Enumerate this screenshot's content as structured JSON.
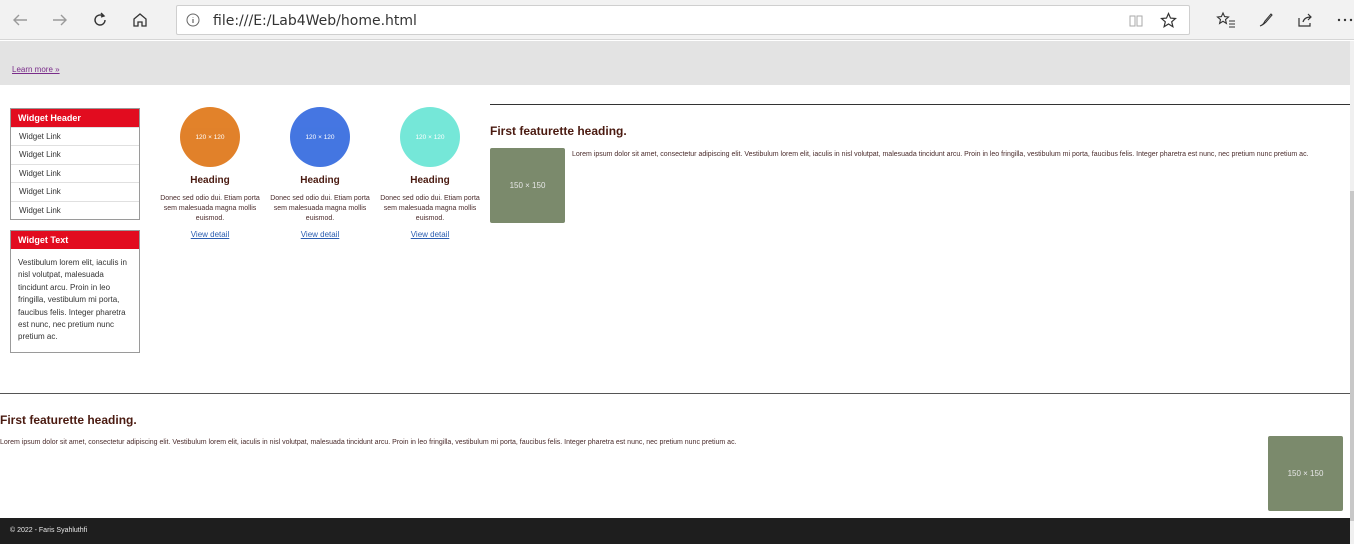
{
  "browser": {
    "url": "file:///E:/Lab4Web/home.html"
  },
  "jumbotron": {
    "learn_more": "Learn more »"
  },
  "sidebar": {
    "widget1": {
      "header": "Widget Header",
      "links": [
        "Widget Link",
        "Widget Link",
        "Widget Link",
        "Widget Link",
        "Widget Link"
      ]
    },
    "widget2": {
      "header": "Widget Text",
      "text": "Vestibulum lorem elit, iaculis in nisl volutpat, malesuada tincidunt arcu. Proin in leo fringilla, vestibulum mi porta, faucibus felis. Integer pharetra est nunc, nec pretium nunc pretium ac."
    }
  },
  "cards": [
    {
      "placeholder": "120 × 120",
      "color": "#e07b1f",
      "heading": "Heading",
      "text": "Donec sed odio dui. Etiam porta sem malesuada magna mollis euismod.",
      "link": "View detail"
    },
    {
      "placeholder": "120 × 120",
      "color": "#3b6fe0",
      "heading": "Heading",
      "text": "Donec sed odio dui. Etiam porta sem malesuada magna mollis euismod.",
      "link": "View detail"
    },
    {
      "placeholder": "120 × 120",
      "color": "#6ee6d6",
      "heading": "Heading",
      "text": "Donec sed odio dui. Etiam porta sem malesuada magna mollis euismod.",
      "link": "View detail"
    }
  ],
  "featurette1": {
    "heading": "First featurette heading.",
    "image": "150 × 150",
    "text": "Lorem ipsum dolor sit amet, consectetur adipiscing elit. Vestibulum lorem elit, iaculis in nisl volutpat, malesuada tincidunt arcu. Proin in leo fringilla, vestibulum mi porta, faucibus felis. Integer pharetra est nunc, nec pretium nunc pretium ac."
  },
  "featurette2": {
    "heading": "First featurette heading.",
    "image": "150 × 150",
    "text": "Lorem ipsum dolor sit amet, consectetur adipiscing elit. Vestibulum lorem elit, iaculis in nisl volutpat, malesuada tincidunt arcu. Proin in leo fringilla, vestibulum mi porta, faucibus felis. Integer pharetra est nunc, nec pretium nunc pretium ac."
  },
  "footer": {
    "text": "© 2022 - Faris Syahluthfi"
  },
  "colors": {
    "widget_header": "#e20c1f",
    "footer_bg": "#1e1e1e",
    "thumb_bg": "#7b8a6c"
  }
}
